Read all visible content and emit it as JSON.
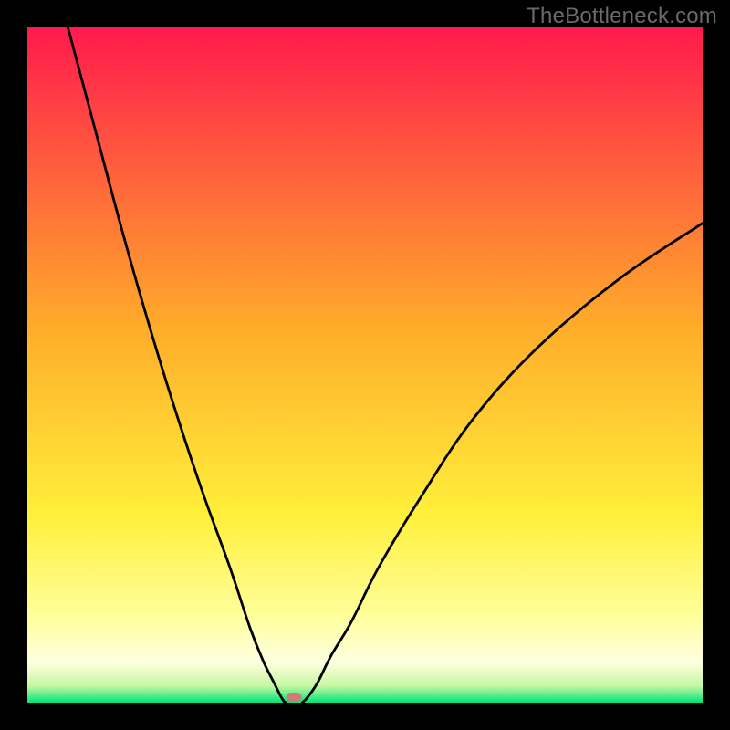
{
  "watermark": "TheBottleneck.com",
  "colors": {
    "top": "#ff1a4d",
    "mid_upper": "#ff8a2a",
    "mid": "#ffd400",
    "mid_lower": "#ffff66",
    "pale": "#ffffcc",
    "bottom": "#00e57a",
    "curve": "#000000",
    "marker": "#cd7c78",
    "frame": "#000000"
  },
  "chart_data": {
    "type": "line",
    "title": "",
    "xlabel": "",
    "ylabel": "",
    "xlim": [
      0,
      100
    ],
    "ylim": [
      0,
      100
    ],
    "grid": false,
    "legend": false,
    "series": [
      {
        "name": "left-branch",
        "x": [
          6,
          10,
          14,
          18,
          22,
          26,
          30,
          33,
          35,
          36.5,
          37.5,
          38,
          38.3
        ],
        "y": [
          100,
          85,
          70,
          56,
          43,
          31,
          20,
          11,
          6,
          3,
          1,
          0.2,
          0
        ]
      },
      {
        "name": "right-branch",
        "x": [
          40.7,
          41.5,
          43,
          45,
          48,
          52,
          58,
          66,
          76,
          88,
          100
        ],
        "y": [
          0,
          0.8,
          3,
          7,
          12,
          20,
          30,
          42,
          53,
          63,
          71
        ]
      }
    ],
    "annotations": [
      {
        "name": "optimal-marker",
        "x": 39.5,
        "y": 0.8
      }
    ],
    "background_gradient": {
      "direction": "vertical",
      "stops": [
        {
          "pos": 0.0,
          "color": "#ff1a4d"
        },
        {
          "pos": 0.45,
          "color": "#ffae2a"
        },
        {
          "pos": 0.72,
          "color": "#ffef3a"
        },
        {
          "pos": 0.87,
          "color": "#ffff9a"
        },
        {
          "pos": 0.94,
          "color": "#ffffe0"
        },
        {
          "pos": 0.975,
          "color": "#c7f7a0"
        },
        {
          "pos": 1.0,
          "color": "#00e57a"
        }
      ]
    }
  }
}
